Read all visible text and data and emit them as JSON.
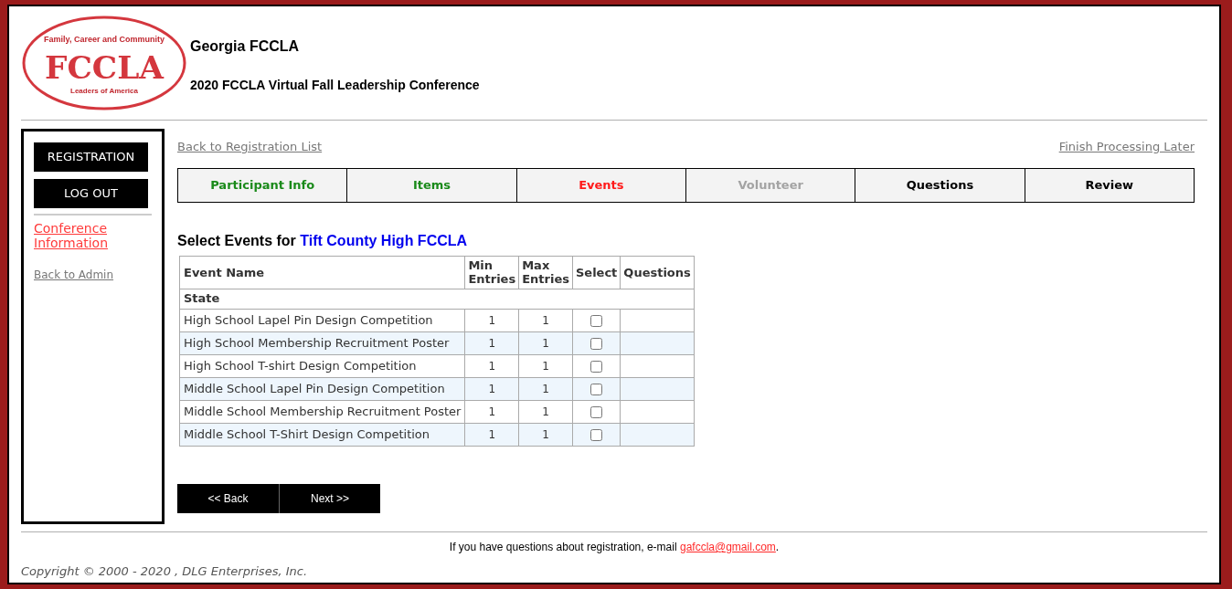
{
  "logo": {
    "wordmark": "FCCLA",
    "top_arc": "Family, Career and Community",
    "bottom_arc": "Leaders of America"
  },
  "header": {
    "title": "Georgia FCCLA",
    "subtitle": "2020 FCCLA Virtual Fall Leadership Conference"
  },
  "sidebar": {
    "buttons": [
      "REGISTRATION",
      "LOG OUT"
    ],
    "links": [
      {
        "label": "Conference Information",
        "kind": "highlight"
      },
      {
        "label": "Back to Admin",
        "kind": "plain"
      }
    ]
  },
  "top_links": {
    "left": "Back to Registration List",
    "right": "Finish Processing Later"
  },
  "tabs": [
    {
      "label": "Participant Info",
      "completed": true,
      "disabled": false,
      "selected": false
    },
    {
      "label": "Items",
      "completed": true,
      "disabled": false,
      "selected": false
    },
    {
      "label": "Events",
      "completed": false,
      "disabled": false,
      "selected": true
    },
    {
      "label": "Volunteer",
      "completed": false,
      "disabled": true,
      "selected": false
    },
    {
      "label": "Questions",
      "completed": false,
      "disabled": false,
      "selected": false
    },
    {
      "label": "Review",
      "completed": false,
      "disabled": false,
      "selected": false
    }
  ],
  "heading": {
    "prefix": "Select Events for",
    "chapter": "Tift County High FCCLA"
  },
  "table": {
    "columns": [
      "Event Name",
      "Min Entries",
      "Max Entries",
      "Select",
      "Questions"
    ],
    "group": "State",
    "rows": [
      {
        "name": "High School Lapel Pin Design Competition",
        "min": "1",
        "max": "1",
        "checked": false
      },
      {
        "name": "High School Membership Recruitment Poster",
        "min": "1",
        "max": "1",
        "checked": false
      },
      {
        "name": "High School T-shirt Design Competition",
        "min": "1",
        "max": "1",
        "checked": false
      },
      {
        "name": "Middle School Lapel Pin Design Competition",
        "min": "1",
        "max": "1",
        "checked": false
      },
      {
        "name": "Middle School Membership Recruitment Poster",
        "min": "1",
        "max": "1",
        "checked": false
      },
      {
        "name": "Middle School T-Shirt Design Competition",
        "min": "1",
        "max": "1",
        "checked": false
      }
    ]
  },
  "nav_buttons": [
    "<< Back",
    "Next >>"
  ],
  "footer": {
    "prefix": "If you have questions about registration, e-mail ",
    "email": "gafccla@gmail.com",
    "suffix": ".",
    "copyright": "Copyright © 2000 - 2020 , DLG Enterprises, Inc."
  }
}
